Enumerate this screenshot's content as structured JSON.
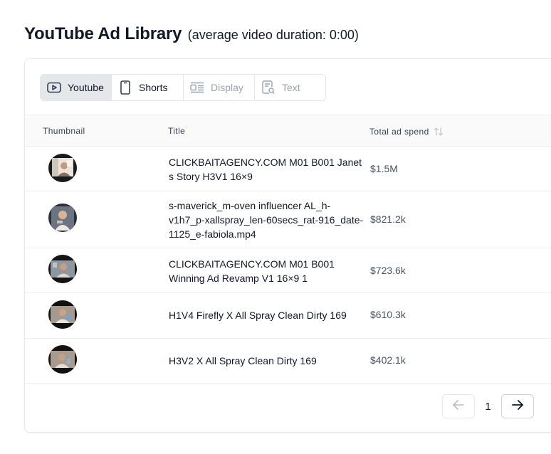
{
  "header": {
    "title": "YouTube Ad Library",
    "subtitle": "(average video duration: 0:00)"
  },
  "tabs": [
    {
      "label": "Youtube",
      "icon": "play-rectangle-icon",
      "state": "active"
    },
    {
      "label": "Shorts",
      "icon": "mobile-phone-icon",
      "state": "enabled"
    },
    {
      "label": "Display",
      "icon": "display-layout-icon",
      "state": "disabled"
    },
    {
      "label": "Text",
      "icon": "text-search-icon",
      "state": "disabled"
    }
  ],
  "table": {
    "columns": [
      "Thumbnail",
      "Title",
      "Total ad spend"
    ],
    "sort_icon": "sort-arrows-icon",
    "rows": [
      {
        "title": "CLICKBAITAGENCY.COM M01 B001 Janet s Story H3V1 16×9",
        "spend": "$1.5M"
      },
      {
        "title": "s-maverick_m-oven influencer AL_h-v1h7_p-xallspray_len-60secs_rat-916_date-1125_e-fabiola.mp4",
        "spend": "$821.2k"
      },
      {
        "title": "CLICKBAITAGENCY.COM M01 B001 Winning Ad Revamp V1 16×9 1",
        "spend": "$723.6k"
      },
      {
        "title": "H1V4 Firefly X All Spray Clean Dirty 169",
        "spend": "$610.3k"
      },
      {
        "title": "H3V2 X All Spray Clean Dirty 169",
        "spend": "$402.1k"
      }
    ]
  },
  "pagination": {
    "current_page": "1",
    "prev_icon": "arrow-left-icon",
    "next_icon": "arrow-right-icon"
  },
  "colors": {
    "active_tab_bg": "#e5e7eb",
    "disabled_text": "#9ca3af",
    "spend_text": "#4b5563"
  }
}
